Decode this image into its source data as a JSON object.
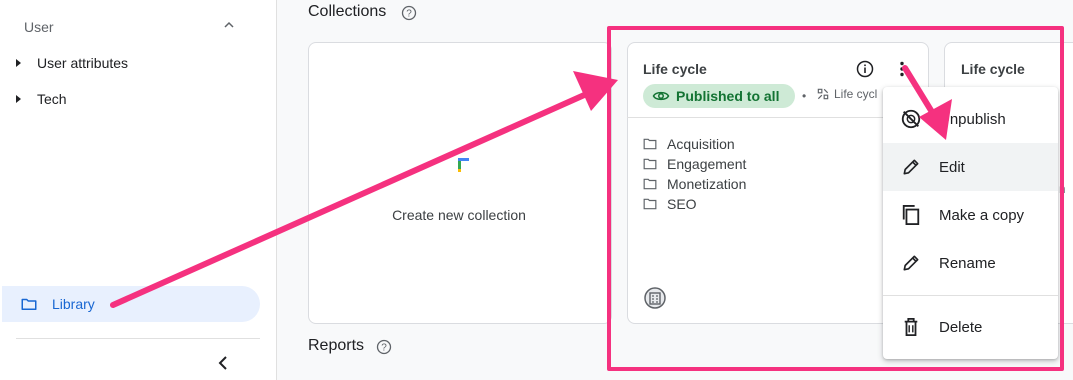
{
  "sidebar": {
    "section_title": "User",
    "items": [
      {
        "label": "User attributes"
      },
      {
        "label": "Tech"
      }
    ],
    "library_label": "Library"
  },
  "main": {
    "collections_heading": "Collections",
    "reports_heading": "Reports",
    "new_collection_label": "Create new collection",
    "cards": [
      {
        "title": "Life cycle",
        "status": "Published to all",
        "type_label": "Life cycl",
        "folders": [
          "Acquisition",
          "Engagement",
          "Monetization",
          "SEO"
        ]
      },
      {
        "title": "Life cycle"
      }
    ],
    "peek_text": "n"
  },
  "menu": {
    "items": [
      {
        "label": "Unpublish",
        "icon": "unpublish-icon"
      },
      {
        "label": "Edit",
        "icon": "pencil-icon"
      },
      {
        "label": "Make a copy",
        "icon": "copy-icon"
      },
      {
        "label": "Rename",
        "icon": "pencil-icon"
      },
      {
        "label": "Delete",
        "icon": "trash-icon"
      }
    ]
  },
  "colors": {
    "annotation": "#f5317f",
    "published_bg": "#ceead6",
    "published_text": "#137333",
    "library_active_bg": "#e8f0fe",
    "library_active_text": "#1967d2"
  }
}
